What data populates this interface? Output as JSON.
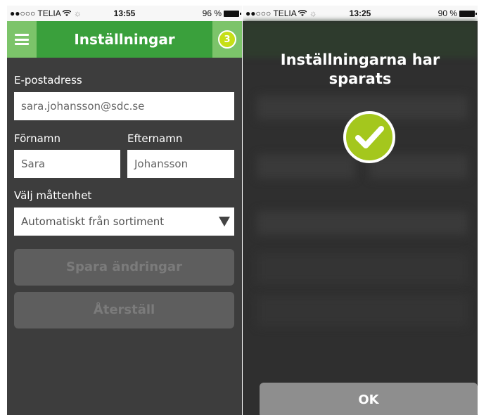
{
  "left": {
    "status": {
      "carrier": "●●○○○ TELIA",
      "time": "13:55",
      "battery": "96 %"
    },
    "header": {
      "title": "Inställningar",
      "badge": "3"
    },
    "form": {
      "email_label": "E-postadress",
      "email_value": "sara.johansson@sdc.se",
      "firstname_label": "Förnamn",
      "firstname_value": "Sara",
      "lastname_label": "Efternamn",
      "lastname_value": "Johansson",
      "unit_label": "Välj måttenhet",
      "unit_value": "Automatiskt från sortiment",
      "save_label": "Spara ändringar",
      "reset_label": "Återställ"
    }
  },
  "right": {
    "status": {
      "carrier": "●●○○○ TELIA",
      "time": "13:25",
      "battery": "90 %"
    },
    "modal": {
      "message": "Inställningarna har sparats",
      "ok_label": "OK"
    }
  },
  "colors": {
    "accent_green": "#3aa03c",
    "light_green": "#7cc46a",
    "lime": "#a4c71d",
    "background": "#3d3d3d"
  },
  "icons": {
    "menu": "hamburger-icon",
    "badge": "count-badge",
    "wifi": "wifi-icon",
    "battery": "battery-icon",
    "dropdown": "dropdown-arrow-icon",
    "check": "checkmark-icon"
  }
}
